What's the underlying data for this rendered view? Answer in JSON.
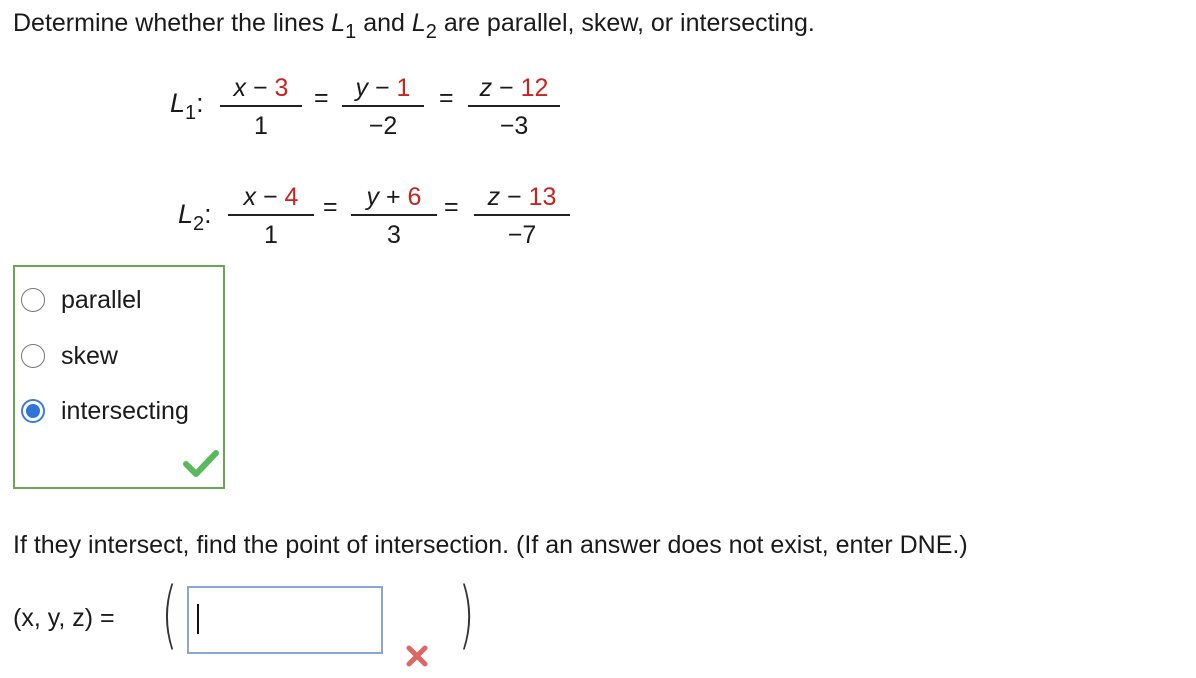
{
  "question": {
    "prefix": "Determine whether the lines ",
    "l1_letter": "L",
    "l1_sub": "1",
    "and": " and ",
    "l2_letter": "L",
    "l2_sub": "2",
    "suffix": " are parallel, skew, or intersecting."
  },
  "line1": {
    "name": "L",
    "sub": "1",
    "colon": ":",
    "x_var": "x",
    "x_op": "−",
    "x_const": "3",
    "x_den": "1",
    "y_var": "y",
    "y_op": "−",
    "y_const": "1",
    "y_den": "−2",
    "z_var": "z",
    "z_op": "−",
    "z_const": "12",
    "z_den": "−3",
    "eq": "="
  },
  "line2": {
    "name": "L",
    "sub": "2",
    "colon": ":",
    "x_var": "x",
    "x_op": "−",
    "x_const": "4",
    "x_den": "1",
    "y_var": "y",
    "y_op": "+",
    "y_const": "6",
    "y_den": "3",
    "z_var": "z",
    "z_op": "−",
    "z_const": "13",
    "z_den": "−7",
    "eq": "="
  },
  "choices": {
    "options": [
      {
        "label": "parallel",
        "selected": false
      },
      {
        "label": "skew",
        "selected": false
      },
      {
        "label": "intersecting",
        "selected": true
      }
    ],
    "status_icon": "checkmark-icon",
    "border_color": "#6aa84f"
  },
  "part2": {
    "prompt": "If they intersect, find the point of intersection. (If an answer does not exist, enter DNE.)",
    "xyz_label": "(x, y, z) =",
    "left_paren": "(",
    "right_paren": ")",
    "input_value": "",
    "status_icon": "x-mark-icon"
  },
  "colors": {
    "constant_red": "#c8231f",
    "radio_blue": "#2f74d6",
    "check_green": "#5cb85c",
    "x_red": "#e06666"
  }
}
